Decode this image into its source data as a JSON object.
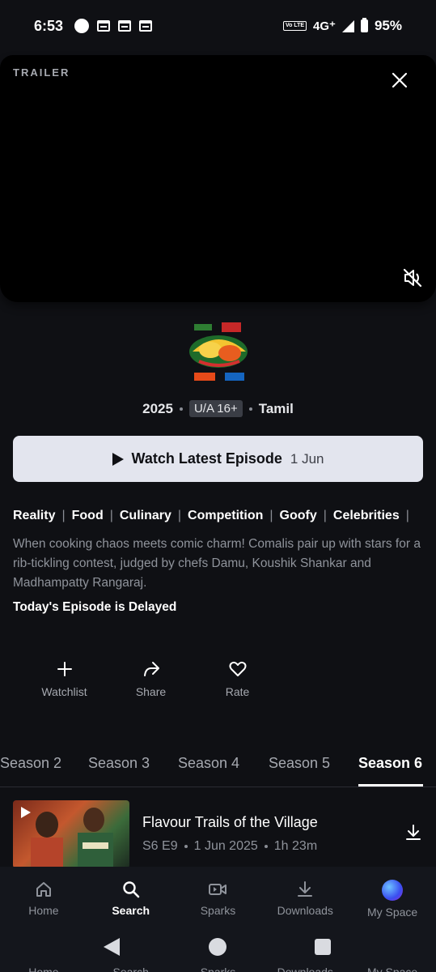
{
  "status": {
    "time": "6:53",
    "volte": "Vo LTE",
    "network": "4G⁺",
    "battery": "95%"
  },
  "trailer": {
    "label": "TRAILER",
    "close_icon": "close-icon",
    "mute_icon": "volume-muted-icon"
  },
  "show": {
    "logo_icon": "show-logo-cooku-with-comali",
    "year": "2025",
    "rating": "U/A 16+",
    "language": "Tamil"
  },
  "watch_button": {
    "label": "Watch Latest Episode",
    "date": "1 Jun"
  },
  "genres": [
    "Reality",
    "Food",
    "Culinary",
    "Competition",
    "Goofy",
    "Celebrities"
  ],
  "description": "When cooking chaos meets comic charm! Comalis pair up with stars for a rib-tickling contest, judged by chefs Damu, Koushik Shankar and Madhampatty Rangaraj.",
  "delay_note": "Today's Episode is Delayed",
  "actions": [
    {
      "label": "Watchlist",
      "icon": "plus-icon"
    },
    {
      "label": "Share",
      "icon": "share-icon"
    },
    {
      "label": "Rate",
      "icon": "heart-icon"
    }
  ],
  "seasons": {
    "tabs": [
      "Season 2",
      "Season 3",
      "Season 4",
      "Season 5",
      "Season 6"
    ],
    "active": "Season 6"
  },
  "episode": {
    "title": "Flavour Trails of the Village",
    "code": "S6 E9",
    "date": "1 Jun 2025",
    "duration": "1h 23m",
    "download_icon": "download-icon"
  },
  "bottom_nav": [
    {
      "label": "Home",
      "icon": "home-icon"
    },
    {
      "label": "Search",
      "icon": "search-icon"
    },
    {
      "label": "Sparks",
      "icon": "video-icon"
    },
    {
      "label": "Downloads",
      "icon": "download-icon"
    },
    {
      "label": "My Space",
      "icon": "avatar-icon"
    }
  ],
  "colors": {
    "background": "#0f1014",
    "button": "#e3e5ee",
    "muted_text": "#8f939b"
  }
}
